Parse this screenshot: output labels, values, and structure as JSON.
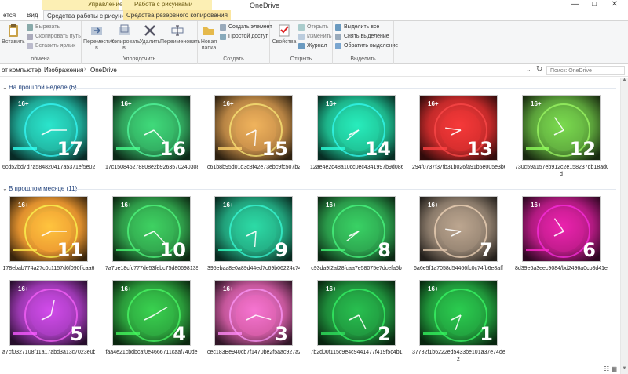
{
  "window": {
    "title": "OneDrive",
    "context_groups": [
      "Управление",
      "Работа с рисунками"
    ],
    "tabs": [
      {
        "label": "ется",
        "active": false,
        "ctx": false
      },
      {
        "label": "Вид",
        "active": false,
        "ctx": false
      },
      {
        "label": "Средства работы с рисунками",
        "active": true,
        "ctx": true
      },
      {
        "label": "Средства резервного копирования",
        "active": false,
        "ctx": true
      }
    ],
    "controls": [
      "—",
      "□",
      "✕"
    ]
  },
  "ribbon": {
    "groups": [
      {
        "label": "обмена",
        "big": [
          {
            "label": "Вставить",
            "icon": "paste-icon"
          }
        ],
        "small": [
          {
            "label": "Вырезать",
            "icon": "cut-icon"
          },
          {
            "label": "Скопировать путь",
            "icon": "copy-path-icon"
          },
          {
            "label": "Вставить ярлык",
            "icon": "paste-shortcut-icon"
          }
        ]
      },
      {
        "label": "Упорядочить",
        "big": [
          {
            "label": "Переместить в",
            "icon": "move-to-icon"
          },
          {
            "label": "Копировать в",
            "icon": "copy-to-icon"
          },
          {
            "label": "Удалить",
            "icon": "delete-icon"
          },
          {
            "label": "Переименовать",
            "icon": "rename-icon"
          }
        ]
      },
      {
        "label": "Создать",
        "big": [
          {
            "label": "Новая папка",
            "icon": "new-folder-icon"
          }
        ],
        "small": [
          {
            "label": "Создать элемент",
            "icon": "new-item-icon"
          },
          {
            "label": "Простой доступ",
            "icon": "easy-access-icon"
          }
        ]
      },
      {
        "label": "Открыть",
        "big": [
          {
            "label": "Свойства",
            "icon": "properties-icon"
          }
        ],
        "small": [
          {
            "label": "Открыть",
            "icon": "open-icon"
          },
          {
            "label": "Изменить",
            "icon": "edit-icon"
          },
          {
            "label": "Журнал",
            "icon": "history-icon"
          }
        ]
      },
      {
        "label": "Выделить",
        "small": [
          {
            "label": "Выделить все",
            "icon": "select-all-icon"
          },
          {
            "label": "Снять выделение",
            "icon": "select-none-icon"
          },
          {
            "label": "Обратить выделение",
            "icon": "invert-selection-icon"
          }
        ]
      }
    ]
  },
  "address": {
    "crumbs": [
      "от компьютер",
      "Изображения",
      "OneDrive"
    ],
    "search_placeholder": "Поиск: OneDrive",
    "refresh": "↻"
  },
  "groups": [
    {
      "title": "На прошлой неделе (6)",
      "items": [
        {
          "name": "6cd52bd7d7a584820417a5371ef5e02",
          "name2": "",
          "number": "17",
          "color": "#1fa896"
        },
        {
          "name": "17c150846278808e2b9263570240308e",
          "name2": "",
          "number": "16",
          "color": "#2fa05a"
        },
        {
          "name": "c61b8b95d01d3c8f42e73ebc9fc507b2",
          "name2": "",
          "number": "15",
          "color": "#b88444"
        },
        {
          "name": "12ae4e2d48a10cc0ec4341997b9d086f",
          "name2": "",
          "number": "14",
          "color": "#1db48a"
        },
        {
          "name": "294f0737f37fb31b026fa91b5e005e3b6",
          "name2": "",
          "number": "13",
          "color": "#c42a2a"
        },
        {
          "name": "730c59a157eb912c2e158237db18ad0",
          "name2": "d",
          "number": "12",
          "color": "#5aa03a"
        }
      ]
    },
    {
      "title": "В прошлом месяце (11)",
      "items": [
        {
          "name": "178ebab774a27c0c1157d6f090ffcaa6",
          "name2": "",
          "number": "11",
          "color": "#e0902e"
        },
        {
          "name": "7a7be18cfc777de53febc75d80698139",
          "name2": "",
          "number": "10",
          "color": "#2e9a48"
        },
        {
          "name": "395ebaa8e0a89d44ed7c69b06224c741",
          "name2": "",
          "number": "9",
          "color": "#21a07a"
        },
        {
          "name": "c93da9f2af28fcaa7e58075e7dcefa5b",
          "name2": "",
          "number": "8",
          "color": "#2a9a4a"
        },
        {
          "name": "6a6e5f1a7058d54466fc0c74fb6e8aff",
          "name2": "",
          "number": "7",
          "color": "#8a7a6a"
        },
        {
          "name": "8d39e6a3eec9084/bd2496a0cb8d41e0",
          "name2": "",
          "number": "6",
          "color": "#b01a80"
        },
        {
          "name": "a7cf0327108f11a17abd3a13c7023e0b",
          "name2": "",
          "number": "5",
          "color": "#9a38b0"
        },
        {
          "name": "faa4e21cbdbcaf0e4666711caaf740de",
          "name2": "",
          "number": "4",
          "color": "#2a9a3a"
        },
        {
          "name": "cec183Be940cb7f1470be2f5aac927a2",
          "name2": "",
          "number": "3",
          "color": "#c4569a"
        },
        {
          "name": "7b2d00f115c9e4c9441477f419f5c4b1",
          "name2": "",
          "number": "2",
          "color": "#1e8c3a"
        },
        {
          "name": "37782f1b6222ed5433be101a37e74de8",
          "name2": "2",
          "number": "1",
          "color": "#20963a"
        }
      ]
    }
  ],
  "badge": "16+"
}
